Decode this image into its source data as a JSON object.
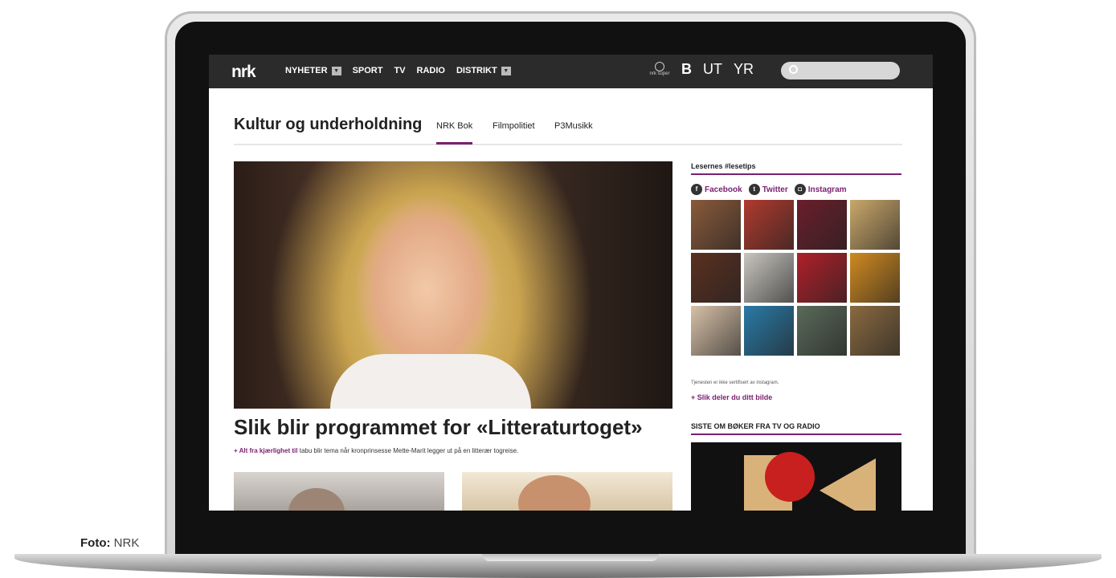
{
  "topbar": {
    "logo": "nrk",
    "nav": [
      {
        "label": "NYHETER",
        "has_dropdown": true
      },
      {
        "label": "SPORT",
        "has_dropdown": false
      },
      {
        "label": "TV",
        "has_dropdown": false
      },
      {
        "label": "RADIO",
        "has_dropdown": false
      },
      {
        "label": "DISTRIKT",
        "has_dropdown": true
      }
    ],
    "super_label": "nrk super",
    "ub_label": "B",
    "ut_label": "UT",
    "yr_label": "YR",
    "search_placeholder": ""
  },
  "section": {
    "title": "Kultur og underholdning",
    "tabs": [
      "NRK Bok",
      "Filmpolitiet",
      "P3Musikk"
    ],
    "active_tab": 0
  },
  "main": {
    "headline": "Slik blir programmet for «Litteraturtoget»",
    "lead_link": "+ Alt fra kjærlighet til",
    "lead_text": " tabu blir tema når kronprinsesse Mette-Marit legger ut på en litterær togreise."
  },
  "sidebar": {
    "title": "Lesernes #lesetips",
    "social": [
      "Facebook",
      "Twitter",
      "Instagram"
    ],
    "note": "Tjenesten er ikke sertifisert av instagram.",
    "share_link": "+ Slik deler du ditt bilde",
    "section2_title": "SISTE OM BØKER FRA TV OG RADIO",
    "tile_colors": [
      "#8a5a3a",
      "#b03a2e",
      "#6a1e2a",
      "#caa86a",
      "#5a3020",
      "#c9c6c0",
      "#b0202a",
      "#d08a20",
      "#d7c1a8",
      "#2a7aa6",
      "#5a6a5a",
      "#8a6a40"
    ]
  },
  "caption": {
    "prefix": "Foto:",
    "source": "NRK"
  }
}
